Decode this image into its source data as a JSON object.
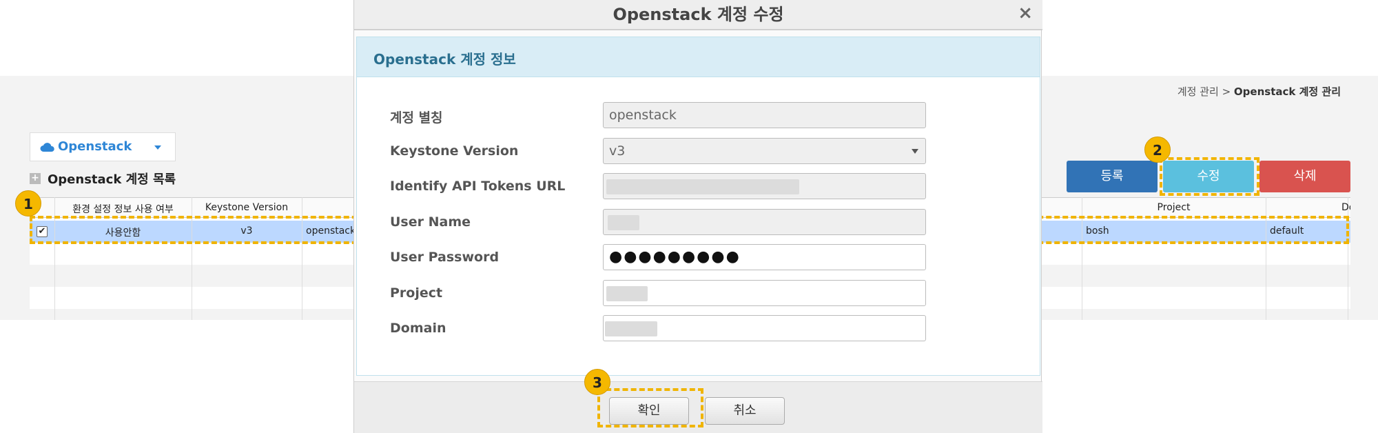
{
  "breadcrumb": {
    "parent": "계정 관리 >",
    "current": "Openstack 계정 관리"
  },
  "provider": {
    "label": "Openstack"
  },
  "list": {
    "title": "Openstack 계정 목록"
  },
  "actions": {
    "register": "등록",
    "edit": "수정",
    "delete": "삭제"
  },
  "table": {
    "columns": [
      "환경 설정 정보 사용 여부",
      "Keystone Version",
      "Project",
      "Do"
    ],
    "row": {
      "usage": "사용안함",
      "version": "v3",
      "alias": "openstack",
      "project": "bosh",
      "domain": "default",
      "checked": "✔"
    }
  },
  "modal": {
    "title": "Openstack 계정 수정",
    "close": "×",
    "section_title": "Openstack 계정 정보",
    "fields": {
      "alias_label": "계정 별칭",
      "alias_value": "openstack",
      "version_label": "Keystone Version",
      "version_value": "v3",
      "url_label": "Identify API Tokens URL",
      "username_label": "User Name",
      "password_label": "User Password",
      "password_value": "●●●●●●●●●",
      "project_label": "Project",
      "domain_label": "Domain"
    },
    "confirm": "확인",
    "cancel": "취소"
  },
  "badges": {
    "one": "1",
    "two": "2",
    "three": "3"
  },
  "colors": {
    "register": "#3173b6",
    "edit": "#5bc0de",
    "delete": "#d9534f",
    "highlight": "#f0b400",
    "selected_row": "#bcd8ff"
  }
}
